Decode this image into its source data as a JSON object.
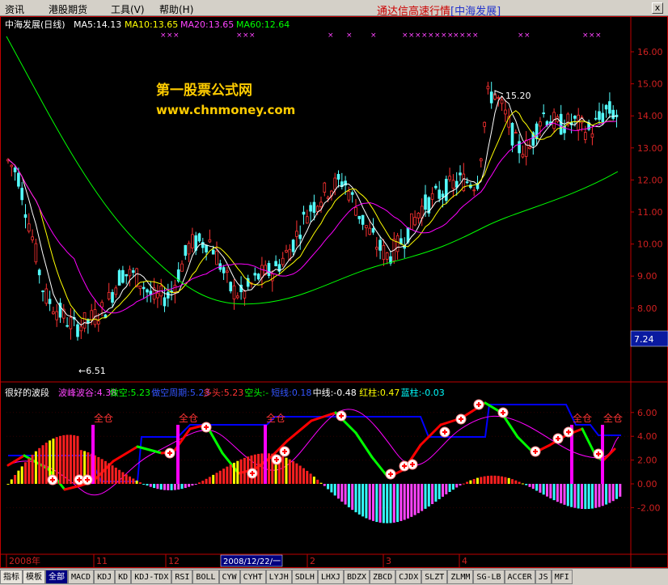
{
  "menu": {
    "items": [
      "资讯",
      "港股期货",
      "工具(V)",
      "帮助(H)"
    ],
    "brand": "通达信高速行情",
    "brand_suffix": "[中海发展]",
    "close": "x"
  },
  "watermark": {
    "line1": "第一股票公式网",
    "line2": "www.chnmoney.com"
  },
  "top_header": {
    "title": "中海发展(日线)",
    "ma5": "MA5:14.13",
    "ma10": "MA10:13.65",
    "ma20": "MA20:13.65",
    "ma60": "MA60:12.64"
  },
  "price_markers": {
    "high": "15.20",
    "low": "6.51",
    "low_arrow": "←6.51",
    "current": "7.24"
  },
  "indicator_header": {
    "name": "很好的波段",
    "parts": [
      {
        "text": "波峰波谷:4.38",
        "color": "#ff44ff"
      },
      {
        "text": "做空:5.23",
        "color": "#00ff00"
      },
      {
        "text": "做空周期:5.23",
        "color": "#3355ff"
      },
      {
        "text": "多头:5.23",
        "color": "#ff3333"
      },
      {
        "text": "空头:-",
        "color": "#00ff00"
      },
      {
        "text": "短线:0.18",
        "color": "#3355ff"
      },
      {
        "text": "中线:-0.48",
        "color": "#ffffff"
      },
      {
        "text": "红柱:0.47",
        "color": "#ffff00"
      },
      {
        "text": "蓝柱:-0.03",
        "color": "#00ffff"
      }
    ]
  },
  "signal_label": "全仓",
  "time_axis": [
    {
      "label": "2008年",
      "highlight": false
    },
    {
      "label": "11",
      "highlight": false
    },
    {
      "label": "12",
      "highlight": false
    },
    {
      "label": "2008/12/22/一",
      "highlight": true
    },
    {
      "label": "2",
      "highlight": false
    },
    {
      "label": "3",
      "highlight": false
    },
    {
      "label": "4",
      "highlight": false
    }
  ],
  "colors": {
    "up_candle": "#ff3232",
    "down_candle": "#54ffff",
    "ma5": "#ffffff",
    "ma10": "#ffff00",
    "ma20": "#ff00ff",
    "ma60": "#00ff00",
    "axis": "#c00000",
    "wave_up": "#ff0000",
    "wave_down": "#00ff00",
    "blue_line": "#0000ff",
    "purple_line": "#ff00ff"
  },
  "chart_data": [
    {
      "type": "candlestick",
      "title": "中海发展(日线)",
      "y_ticks": [
        16.0,
        15.0,
        14.0,
        13.0,
        12.0,
        11.0,
        10.0,
        9.0,
        8.0
      ],
      "ylim": [
        6.0,
        17.0
      ],
      "series": [
        {
          "name": "MA5",
          "value": 14.13
        },
        {
          "name": "MA10",
          "value": 13.65
        },
        {
          "name": "MA20",
          "value": 13.65
        },
        {
          "name": "MA60",
          "value": 12.64
        }
      ],
      "annotations": [
        {
          "text": "15.20",
          "value": 15.2
        },
        {
          "text": "←6.51",
          "value": 6.51
        },
        {
          "text": "7.24",
          "value": 7.24
        }
      ]
    },
    {
      "type": "line",
      "title": "很好的波段",
      "y_ticks": [
        6.0,
        4.0,
        2.0,
        0.0,
        -2.0
      ],
      "ylim": [
        -4.5,
        7.5
      ]
    }
  ]
}
